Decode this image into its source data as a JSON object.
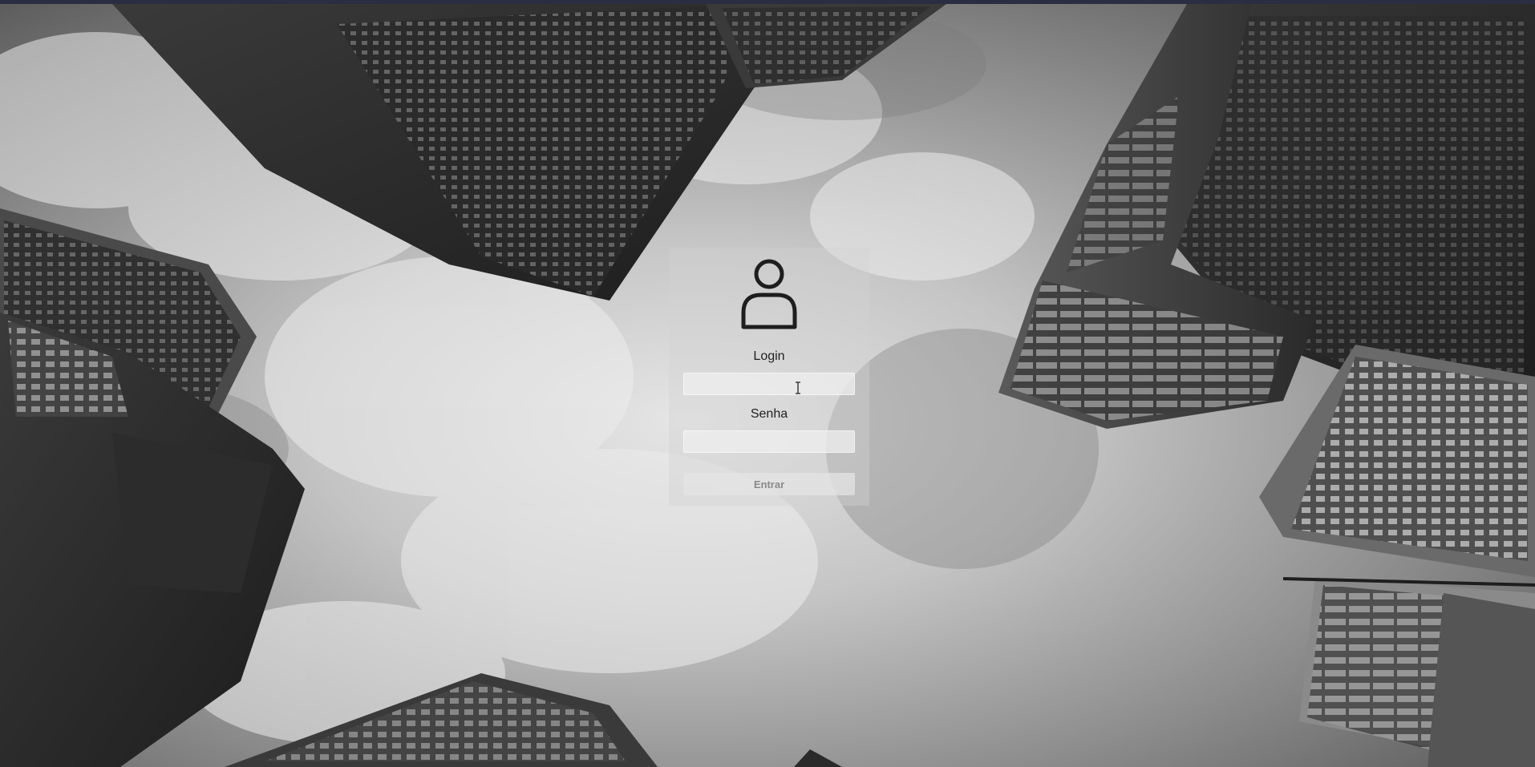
{
  "background": {
    "description_icon": "city-skyline-background",
    "sky_color": "#b5b5b5"
  },
  "login_form": {
    "avatar_icon": "user-icon",
    "login_label": "Login",
    "login_value": "",
    "password_label": "Senha",
    "password_value": "",
    "submit_label": "Entrar"
  },
  "colors": {
    "card_background": "#d2d2d2",
    "label_text": "#1f1f1f",
    "button_text": "#8a8a8a"
  }
}
